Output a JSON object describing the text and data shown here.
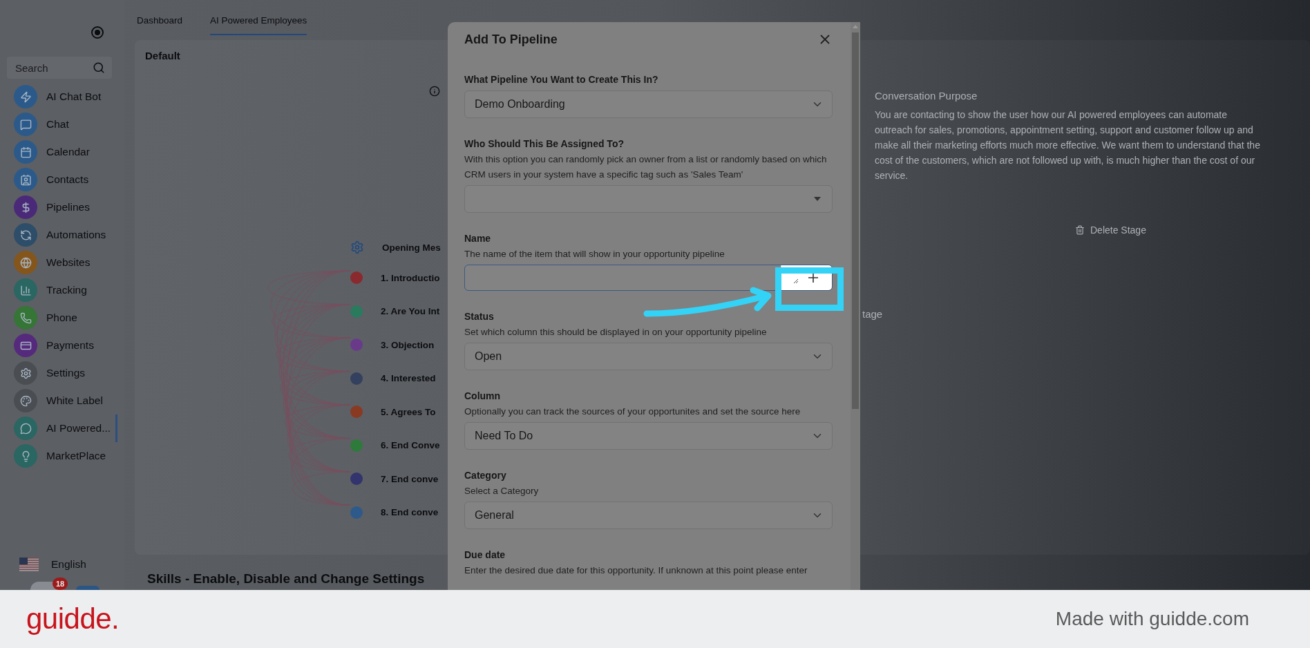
{
  "sidebar": {
    "search": {
      "placeholder": "Search"
    },
    "items": [
      {
        "label": "AI Chat Bot",
        "color": "#2b5a8a",
        "selected": false
      },
      {
        "label": "Chat",
        "color": "#2b5a8a",
        "selected": false
      },
      {
        "label": "Calendar",
        "color": "#2b5a8a",
        "selected": false
      },
      {
        "label": "Contacts",
        "color": "#2b5a8a",
        "selected": false
      },
      {
        "label": "Pipelines",
        "color": "#4a2a78",
        "selected": false
      },
      {
        "label": "Automations",
        "color": "#2d4d68",
        "selected": false
      },
      {
        "label": "Websites",
        "color": "#85561c",
        "selected": false
      },
      {
        "label": "Tracking",
        "color": "#2a6662",
        "selected": false
      },
      {
        "label": "Phone",
        "color": "#357535",
        "selected": false
      },
      {
        "label": "Payments",
        "color": "#552a7c",
        "selected": false
      },
      {
        "label": "Settings",
        "color": "#4a4d52",
        "selected": false
      },
      {
        "label": "White Label",
        "color": "#4a4d52",
        "selected": false
      },
      {
        "label": "AI Powered...",
        "color": "#2a6662",
        "selected": true
      },
      {
        "label": "MarketPlace",
        "color": "#2a6662",
        "selected": false
      }
    ],
    "language": "English",
    "notification_count": "18"
  },
  "tabs": [
    {
      "label": "Dashboard",
      "selected": false
    },
    {
      "label": "AI Powered Employees",
      "selected": true
    }
  ],
  "subtab": "Default",
  "flow": {
    "opening": "Opening Mes",
    "stages": [
      {
        "label": "1. Introductio",
        "color": "#8a2a2e"
      },
      {
        "label": "2. Are You Int",
        "color": "#2a7a5e"
      },
      {
        "label": "3. Objection",
        "color": "#6a3a8a"
      },
      {
        "label": "4. Interested",
        "color": "#33405e"
      },
      {
        "label": "5. Agrees To",
        "color": "#8a3a22"
      },
      {
        "label": "6. End Conve",
        "color": "#2e7a3a"
      },
      {
        "label": "7. End conve",
        "color": "#33336e"
      },
      {
        "label": "8. End conve",
        "color": "#2d5a8a"
      }
    ]
  },
  "conversation_purpose": {
    "title": "Conversation Purpose",
    "text": "You are contacting to show the user how our AI powered employees can automate outreach for sales, promotions, appointment setting, support and customer follow up and make all their marketing efforts much more effective. We want them to understand that the cost of the customers, which are not followed up with, is much higher than the cost of our service."
  },
  "delete_stage": "Delete Stage",
  "stage_fragment": "tage",
  "skills_heading": "Skills - Enable, Disable and Change Settings",
  "modal": {
    "title": "Add To Pipeline",
    "fields": [
      {
        "kind": "select",
        "label": "What Pipeline You Want to Create This In?",
        "value": "Demo Onboarding"
      },
      {
        "kind": "combobox",
        "label": "Who Should This Be Assigned To?",
        "help": "With this option you can randomly pick an owner from a list or randomly based on which CRM users in your system have a specific tag such as 'Sales Team'"
      },
      {
        "kind": "text",
        "label": "Name",
        "help": "The name of the item that will show in your opportunity pipeline",
        "focused": true
      },
      {
        "kind": "select",
        "label": "Status",
        "help": "Set which column this should be displayed in on your opportunity pipeline",
        "value": "Open"
      },
      {
        "kind": "select",
        "label": "Column",
        "help": "Optionally you can track the sources of your opportunites and set the source here",
        "value": "Need To Do"
      },
      {
        "kind": "select",
        "label": "Category",
        "help": "Select a Category",
        "value": "General"
      },
      {
        "kind": "date",
        "label": "Due date",
        "help": "Enter the desired due date for this opportunity. If unknown at this point please enter"
      }
    ]
  },
  "footer": {
    "logo": "guidde.",
    "credit": "Made with guidde.com"
  }
}
